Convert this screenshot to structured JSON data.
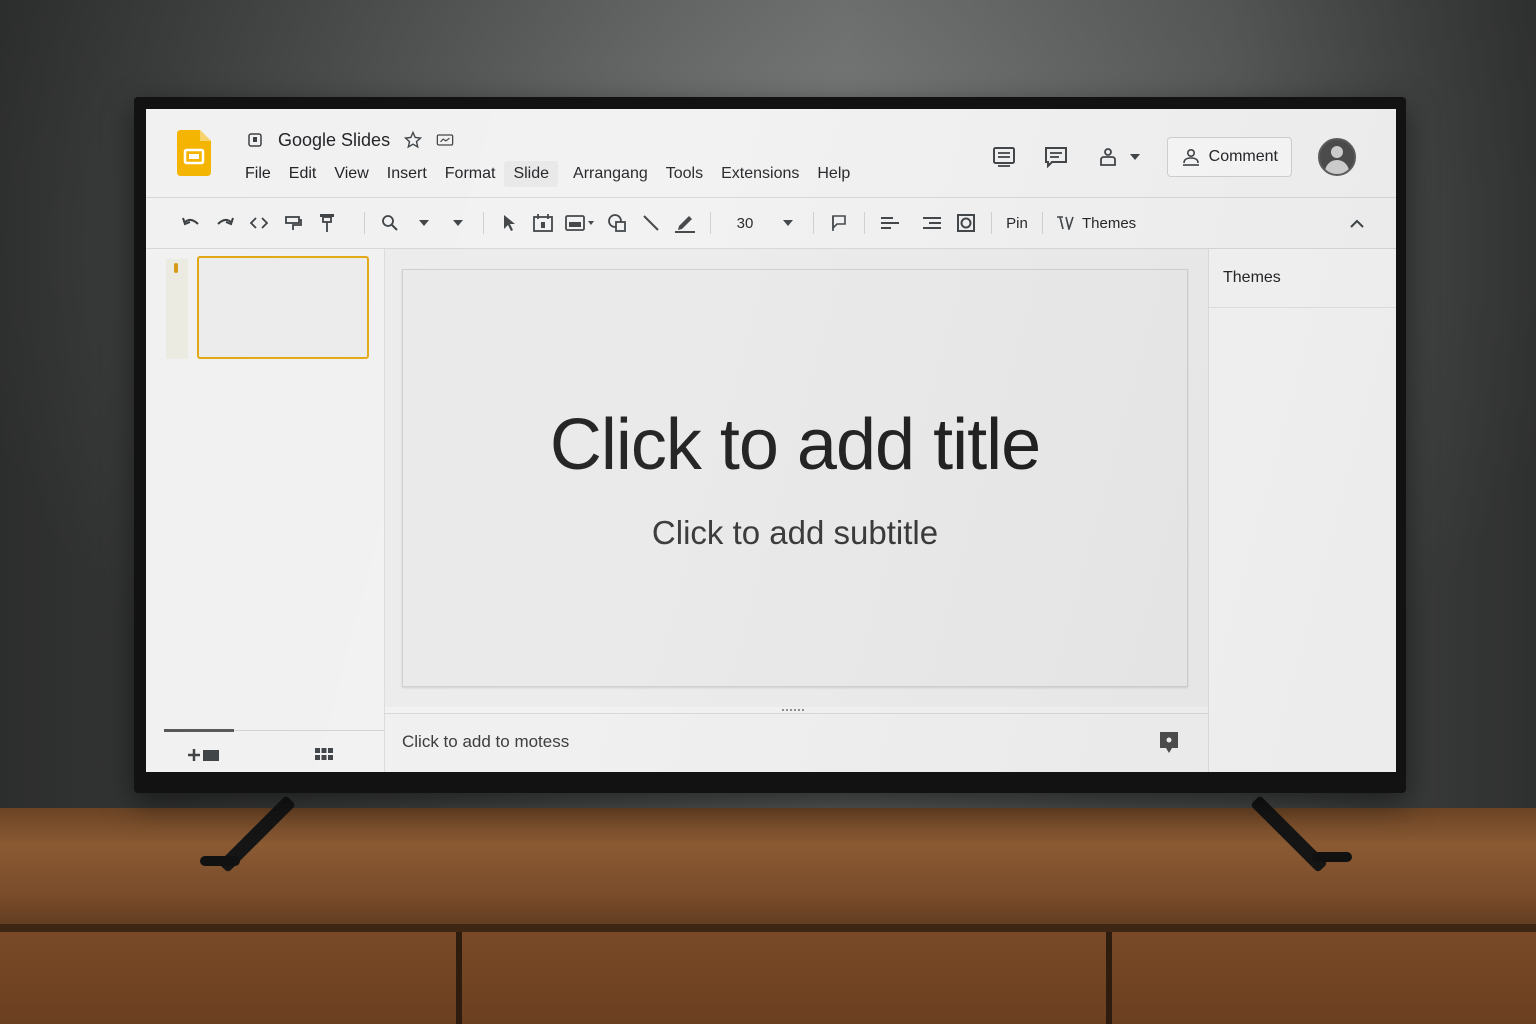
{
  "app": {
    "title": "Google Slides",
    "menu": [
      "File",
      "Edit",
      "View",
      "Insert",
      "Format",
      "Slide",
      "Arrangang",
      "Tools",
      "Extensions",
      "Help"
    ],
    "active_menu_index": 5,
    "accent_color": "#F4B400"
  },
  "header": {
    "comment_label": "Comment",
    "icons": [
      "slideshow-icon",
      "comments-icon",
      "share-person-icon",
      "chevron-down-icon",
      "account-avatar"
    ]
  },
  "toolbar": {
    "font_size": "30",
    "pin_label": "Pin",
    "themes_label": "Themes",
    "icons": [
      "undo-icon",
      "redo-icon",
      "code-icon",
      "paint-format-icon",
      "pin-icon",
      "zoom-icon",
      "dropdown-icon",
      "dropdown-icon",
      "select-cursor-icon",
      "text-box-icon",
      "image-icon",
      "shape-icon",
      "line-icon",
      "pen-icon",
      "dropdown-icon",
      "flag-icon",
      "align-left-icon",
      "align-right-icon",
      "frame-icon",
      "pin-text-icon",
      "themes-icon",
      "collapse-chevron-icon"
    ]
  },
  "filmstrip": {
    "slides": [
      {
        "number": "1",
        "selected": true
      }
    ],
    "icons": [
      "add-slide-icon",
      "grid-view-icon"
    ]
  },
  "slide": {
    "title_placeholder": "Click to add title",
    "subtitle_placeholder": "Click to add subtitle"
  },
  "notes": {
    "placeholder": "Click to add to motess"
  },
  "side_panel": {
    "title": "Themes"
  }
}
